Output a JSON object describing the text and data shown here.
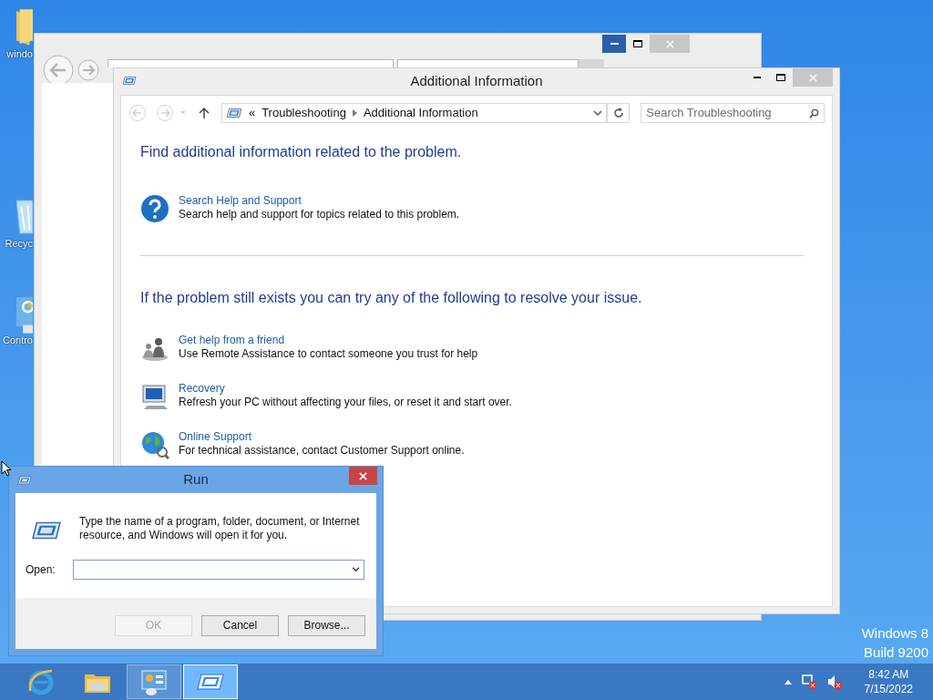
{
  "desktop": {
    "icons": [
      {
        "kind": "folder",
        "label": "windo"
      },
      {
        "kind": "recycle-bin",
        "label": "Recyc"
      },
      {
        "kind": "control-panel",
        "label": "Contro"
      }
    ],
    "watermark": [
      "Windows 8",
      "Build 9200"
    ]
  },
  "troubleshooter": {
    "title": "Additional Information",
    "breadcrumb_prefix": "«",
    "breadcrumb": [
      "Troubleshooting",
      "Additional Information"
    ],
    "search_placeholder": "Search Troubleshooting",
    "heading": "Find additional information related to the problem.",
    "help": [
      {
        "kind": "help",
        "title": "Search Help and Support",
        "description": "Search help and support for topics related to this problem."
      }
    ],
    "heading2": "If the problem still exists you can try any of the following to resolve your issue.",
    "options": [
      {
        "kind": "friend",
        "title": "Get help from a friend",
        "description": "Use Remote Assistance to contact someone you trust for help"
      },
      {
        "kind": "recovery",
        "title": "Recovery",
        "description": "Refresh your PC without affecting your files, or reset it and start over."
      },
      {
        "kind": "globe",
        "title": "Online Support",
        "description": "For technical assistance, contact Customer Support online."
      }
    ]
  },
  "run_dialog": {
    "title": "Run",
    "message": "Type the name of a program, folder, document, or Internet resource, and Windows will open it for you.",
    "open_label": "Open:",
    "buttons": [
      {
        "label": "OK",
        "disabled": true
      },
      {
        "label": "Cancel",
        "disabled": false
      },
      {
        "label": "Browse...",
        "disabled": false
      }
    ]
  },
  "taskbar": {
    "apps": [
      {
        "kind": "ie",
        "running": false,
        "selected": false
      },
      {
        "kind": "explorer",
        "running": false,
        "selected": false
      },
      {
        "kind": "control-panel",
        "running": true,
        "selected": false
      },
      {
        "kind": "run",
        "running": true,
        "selected": true
      }
    ],
    "time": "8:42 AM",
    "date": "7/15/2022"
  }
}
